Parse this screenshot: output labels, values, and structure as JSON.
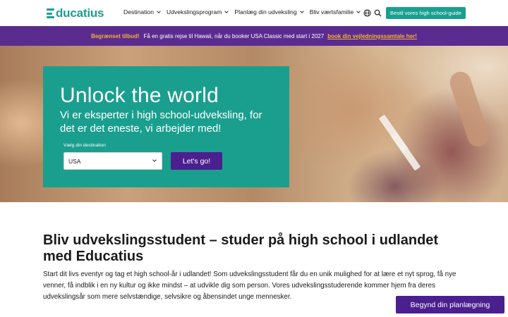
{
  "header": {
    "logo_text": "ducatius",
    "logo_initial": "E",
    "nav": [
      {
        "label": "Destination"
      },
      {
        "label": "Udvekslingsprogram"
      },
      {
        "label": "Planlæg din udveksling"
      },
      {
        "label": "Bliv værtsfamilie"
      }
    ],
    "cta_label": "Bestil vores high school-guide",
    "icons": [
      "globe-icon",
      "search-icon"
    ]
  },
  "promo": {
    "tag": "Begrænset tilbud!",
    "text": "Få en gratis rejse til Hawaii, når du booker USA Classic med start i 2027",
    "link": "book din vejledningssamtale her!"
  },
  "hero": {
    "title": "Unlock the world",
    "subtitle": "Vi er eksperter i high school-udveksling, for det er det eneste, vi arbejder med!",
    "dest_label": "Vælg din destination",
    "dest_value": "USA",
    "go_label": "Let's go!"
  },
  "content": {
    "title": "Bliv udvekslingsstudent – studer på high school i udlandet med Educatius",
    "body": "Start dit livs eventyr og tag et high school-år i udlandet! Som udvekslingsstudent får du en unik mulighed for at lære et nyt sprog, få nye venner, få indblik i en ny kultur og ikke mindst – at udvikle dig som person. Vores udvekslingsstuderende kommer hjem fra deres udvekslingsår som mere selvstændige, selvsikre og åbensindet unge mennesker."
  },
  "floating_cta": "Begynd din planlægning",
  "colors": {
    "teal": "#1a9f8f",
    "purple_bar": "#5b2c8f",
    "purple_button": "#4b1f8e",
    "promo_accent": "#f7b32b"
  }
}
